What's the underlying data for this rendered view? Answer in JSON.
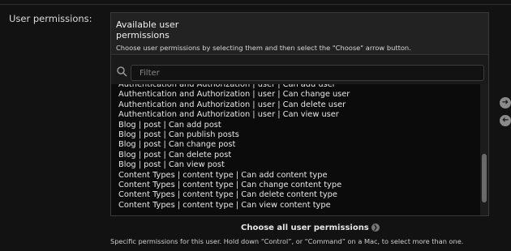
{
  "field": {
    "label": "User permissions:"
  },
  "selector": {
    "title": "Available user permissions",
    "help": "Choose user permissions by selecting them and then select the \"Choose\" arrow button.",
    "filter_placeholder": "Filter",
    "options": [
      "Authentication and Authorization | user | Can add user",
      "Authentication and Authorization | user | Can change user",
      "Authentication and Authorization | user | Can delete user",
      "Authentication and Authorization | user | Can view user",
      "Blog | post | Can add post",
      "Blog | post | Can publish posts",
      "Blog | post | Can change post",
      "Blog | post | Can delete post",
      "Blog | post | Can view post",
      "Content Types | content type | Can add content type",
      "Content Types | content type | Can change content type",
      "Content Types | content type | Can delete content type",
      "Content Types | content type | Can view content type"
    ]
  },
  "actions": {
    "choose_all": "Choose all user permissions"
  },
  "help_text": "Specific permissions for this user. Hold down “Control”, or “Command” on a Mac, to select more than one."
}
